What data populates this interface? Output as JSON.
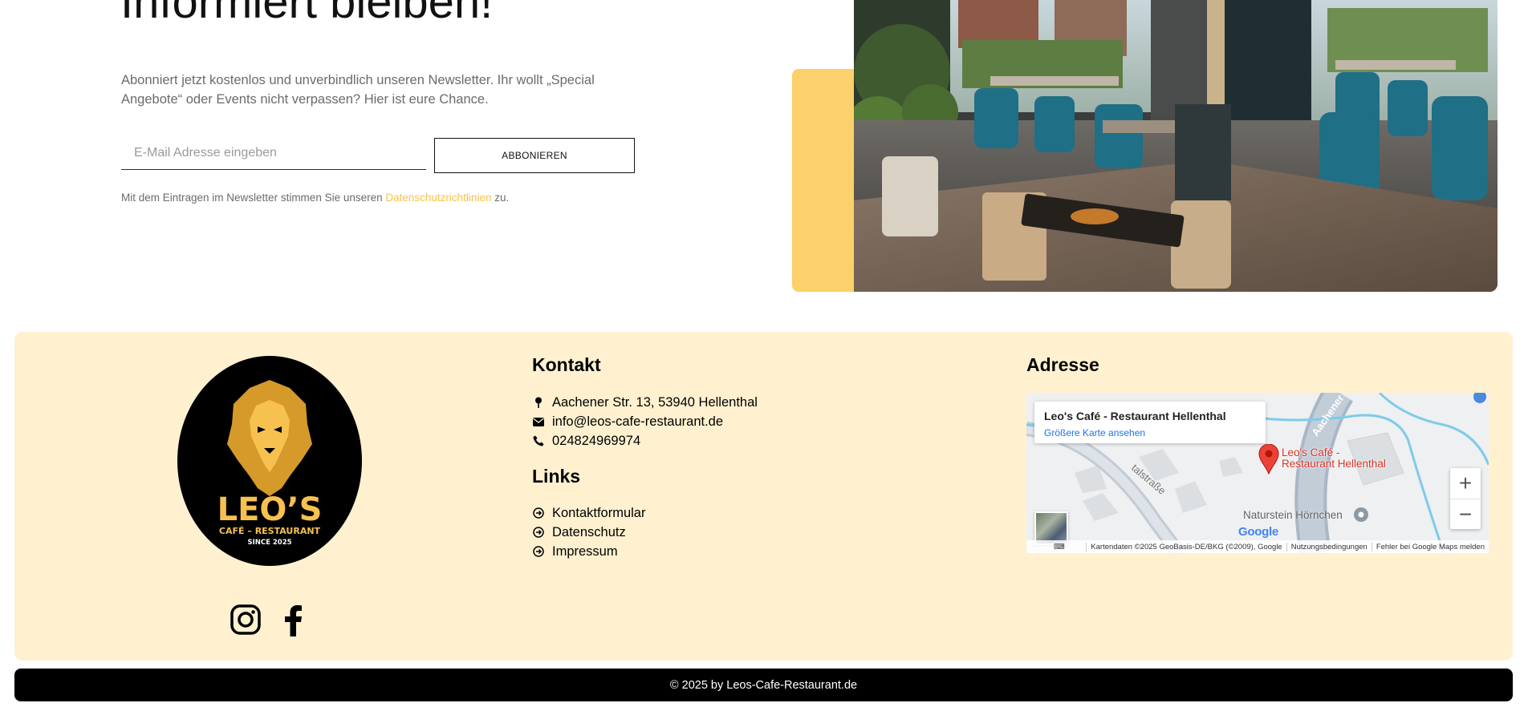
{
  "newsletter": {
    "title": "Informiert bleiben!",
    "description": "Abonniert jetzt kostenlos und unverbindlich unseren Newsletter. Ihr wollt „Special Angebote“ oder Events nicht verpassen? Hier ist eure Chance.",
    "email_placeholder": "E-Mail Adresse eingeben",
    "email_value": "",
    "subscribe_label": "ABBONIEREN",
    "consent_prefix": "Mit dem Eintragen im Newsletter stimmen Sie unseren",
    "consent_link": "Datenschutzrichtlinien",
    "consent_suffix": "zu.",
    "accent_color": "#fcd06a",
    "link_color": "#f7c34a"
  },
  "footer": {
    "background": "#fff1d0",
    "logo": {
      "brand": "LEO’S",
      "tagline": "CAFÉ – RESTAURANT",
      "since": "SINCE 2025"
    },
    "social": [
      {
        "icon": "instagram-icon"
      },
      {
        "icon": "facebook-icon"
      }
    ],
    "contact": {
      "title": "Kontakt",
      "items": [
        {
          "icon": "map-pin-icon",
          "text": "Aachener Str. 13, 53940 Hellenthal"
        },
        {
          "icon": "envelope-icon",
          "text": "info@leos-cafe-restaurant.de"
        },
        {
          "icon": "phone-icon",
          "text": "024824969974"
        }
      ]
    },
    "links": {
      "title": "Links",
      "items": [
        {
          "icon": "arrow-circle-right-icon",
          "text": "Kontaktformular"
        },
        {
          "icon": "arrow-circle-right-icon",
          "text": "Datenschutz"
        },
        {
          "icon": "arrow-circle-right-icon",
          "text": "Impressum"
        }
      ]
    },
    "address": {
      "title": "Adresse",
      "map": {
        "card_title": "Leo's Café - Restaurant Hellenthal",
        "card_link": "Größere Karte ansehen",
        "place_label_line1": "Leo's Café -",
        "place_label_line2": "Restaurant Hellenthal",
        "poi_label": "Naturstein Hörnchen",
        "zoom_in": "+",
        "zoom_out": "−",
        "google_logo": "Google",
        "attribution": "Kartendaten ©2025 GeoBasis-DE/BKG (©2009), Google",
        "terms": "Nutzungsbedingungen",
        "report": "Fehler bei Google Maps melden"
      }
    }
  },
  "copyright": "© 2025 by Leos-Cafe-Restaurant.de"
}
